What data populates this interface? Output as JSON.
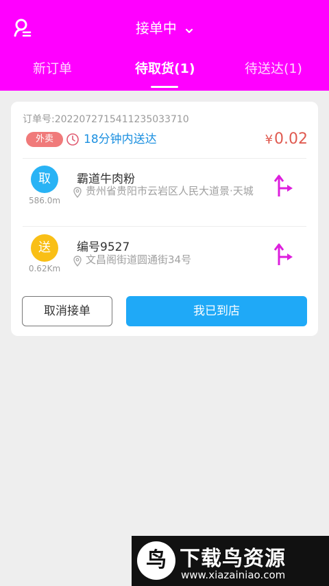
{
  "header": {
    "status_label": "接单中",
    "tabs": [
      {
        "label": "新订单"
      },
      {
        "label": "待取货(1)"
      },
      {
        "label": "待送达(1)"
      }
    ]
  },
  "order": {
    "order_no": "订单号:20220727154112350337​10",
    "tag": "外卖",
    "deliver_time": "18分钟内送达",
    "currency": "¥",
    "price": "0.02",
    "pickup": {
      "badge": "取",
      "distance": "586.0m",
      "name": "霸道牛肉粉",
      "address": "贵州省贵阳市云岩区人民大道景·天城"
    },
    "dropoff": {
      "badge": "送",
      "distance": "0.62Km",
      "name": "编号9527",
      "address": "文昌阁街道圆通街34号"
    },
    "cancel_label": "取消接单",
    "arrive_label": "我已到店"
  },
  "watermark": {
    "logo_char": "鸟",
    "title": "下载鸟资源",
    "url": "www.xiazainiao.com"
  },
  "colors": {
    "header": "#ff00ff",
    "accent_blue": "#1fa9f7",
    "price_red": "#e05a50",
    "pickup_circle": "#29b3f5",
    "dropoff_circle": "#f9bf16"
  },
  "icons": {
    "user": "user-settings-icon",
    "chevron": "chevron-down-icon",
    "clock": "clock-icon",
    "pin": "location-pin-icon",
    "navigate": "route-turn-icon"
  }
}
